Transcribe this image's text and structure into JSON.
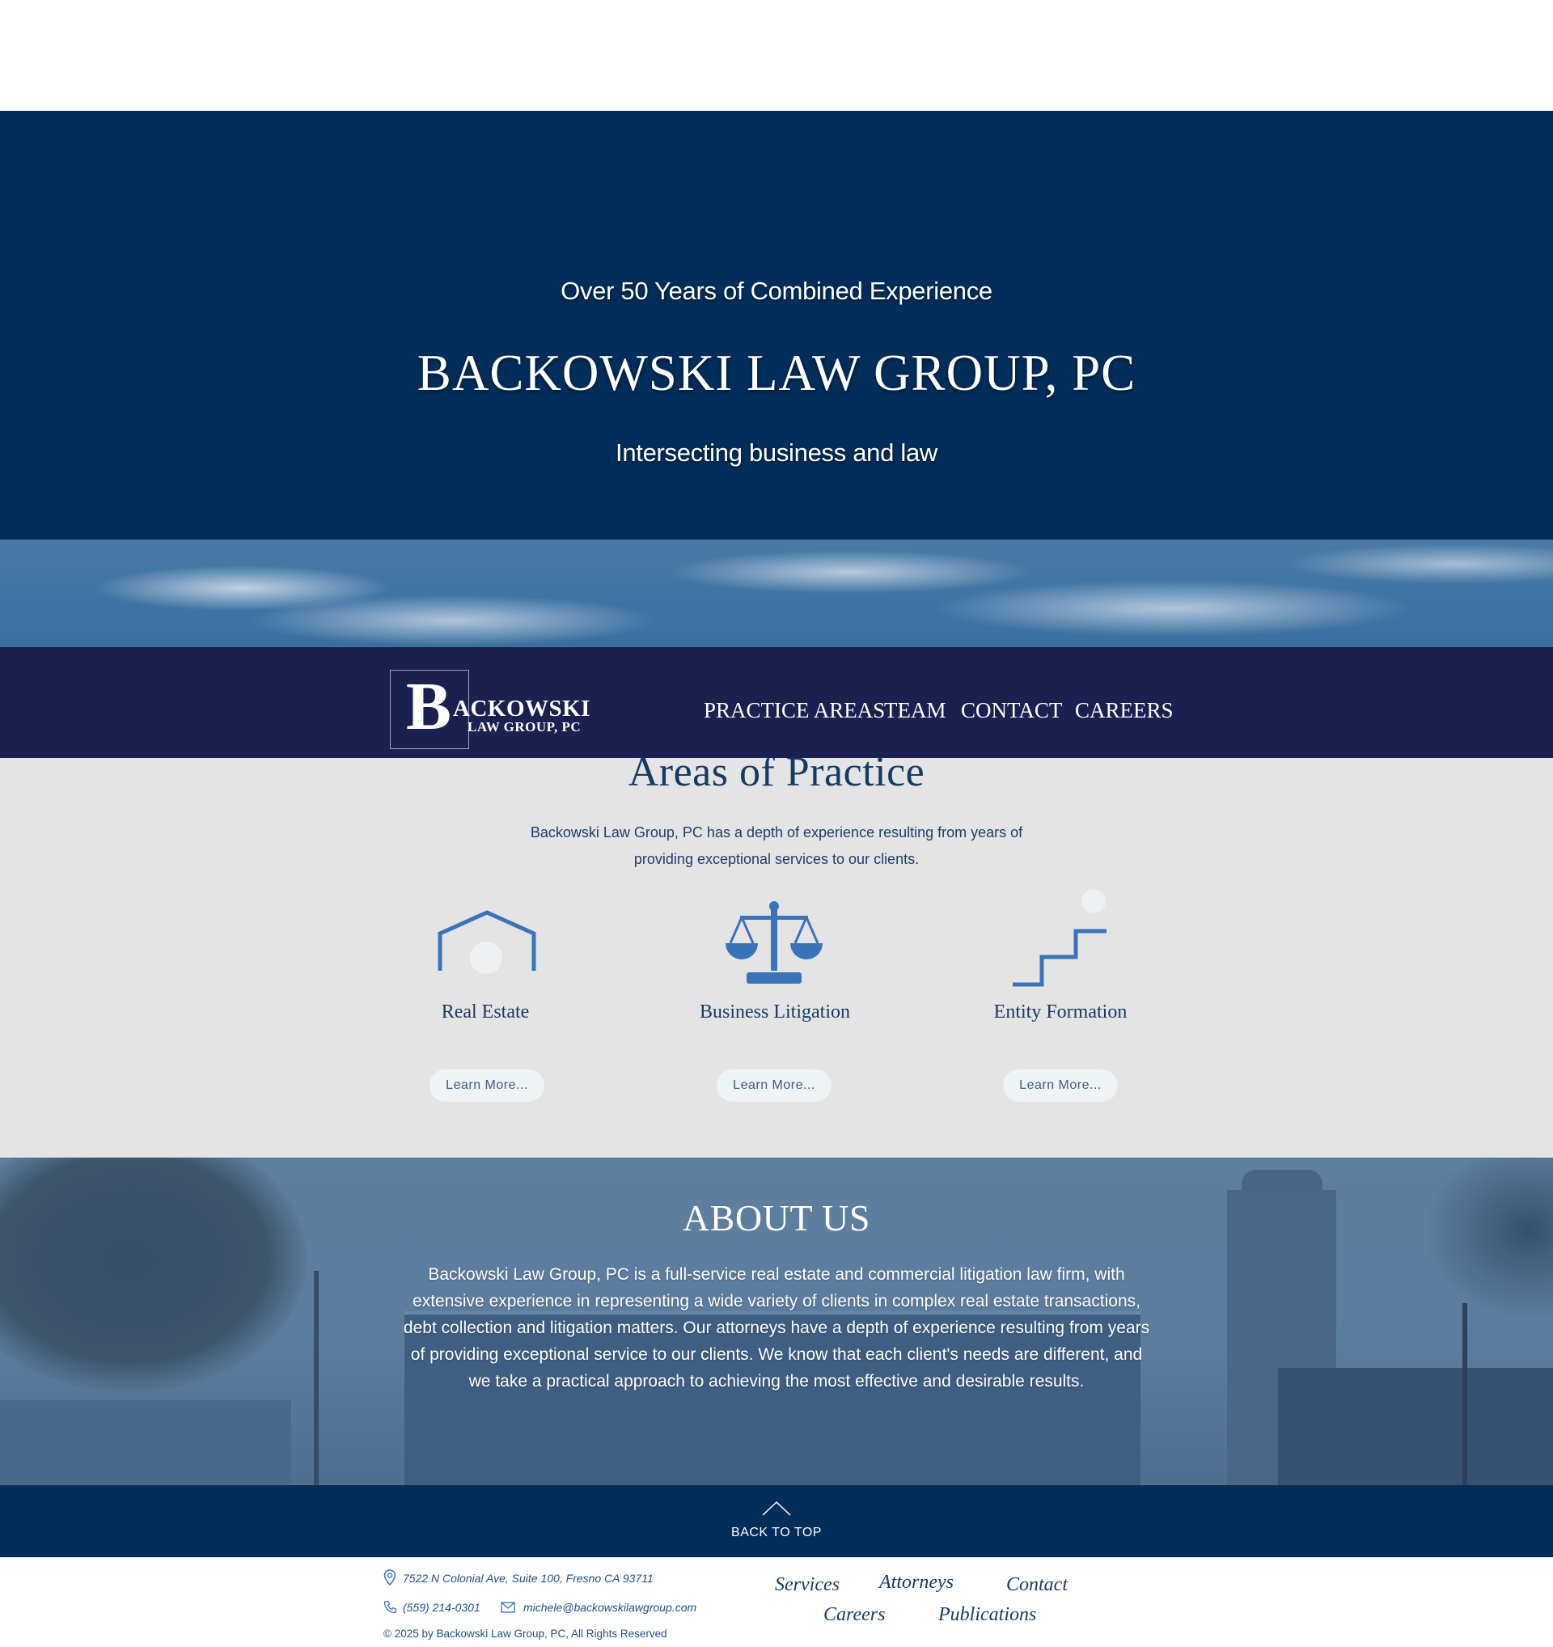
{
  "hero": {
    "tagline": "Over 50 Years of Combined Experience",
    "firm_name": "BACKOWSKI LAW GROUP, PC",
    "subtitle": "Intersecting business and law"
  },
  "header": {
    "logo": {
      "initial": "B",
      "name": "ACKOWSKI",
      "sub": "LAW GROUP, PC"
    },
    "nav": [
      "PRACTICE AREAS",
      "TEAM",
      "CONTACT",
      "CAREERS"
    ]
  },
  "practice": {
    "title": "Areas of Practice",
    "intro": "Backowski Law Group, PC has a depth of experience resulting from years of providing exceptional services to our clients.",
    "services": [
      {
        "title": "Real Estate",
        "icon": "house-icon",
        "button": "Learn More..."
      },
      {
        "title": "Business Litigation",
        "icon": "scales-icon",
        "button": "Learn More..."
      },
      {
        "title": "Entity Formation",
        "icon": "stairs-icon",
        "button": "Learn More..."
      }
    ]
  },
  "about": {
    "title": "ABOUT US",
    "text": "Backowski Law Group, PC is a full-service real estate and commercial litigation law firm, with extensive experience in representing a wide variety of clients in complex real estate transactions, debt collection and litigation matters.  Our attorneys have a depth of experience resulting from years of providing exceptional service to our clients.  We know that each client's needs are different, and we take a practical approach to achieving the most effective and desirable results."
  },
  "back_to_top": "BACK TO TOP",
  "footer": {
    "address": "7522 N Colonial Ave, Suite 100, Fresno CA 93711",
    "phone": "(559) 214-0301",
    "email": "michele@backowskilawgroup.com",
    "copyright": "© 2025 by Backowski Law Group, PC, All Rights Reserved",
    "links": [
      "Services",
      "Attorneys",
      "Contact",
      "Careers",
      "Publications"
    ]
  },
  "colors": {
    "hero_bg": "#002d5a",
    "nav_bg": "#1c2051",
    "practice_bg": "#e4e4e4",
    "icon_blue": "#3a73b8"
  }
}
